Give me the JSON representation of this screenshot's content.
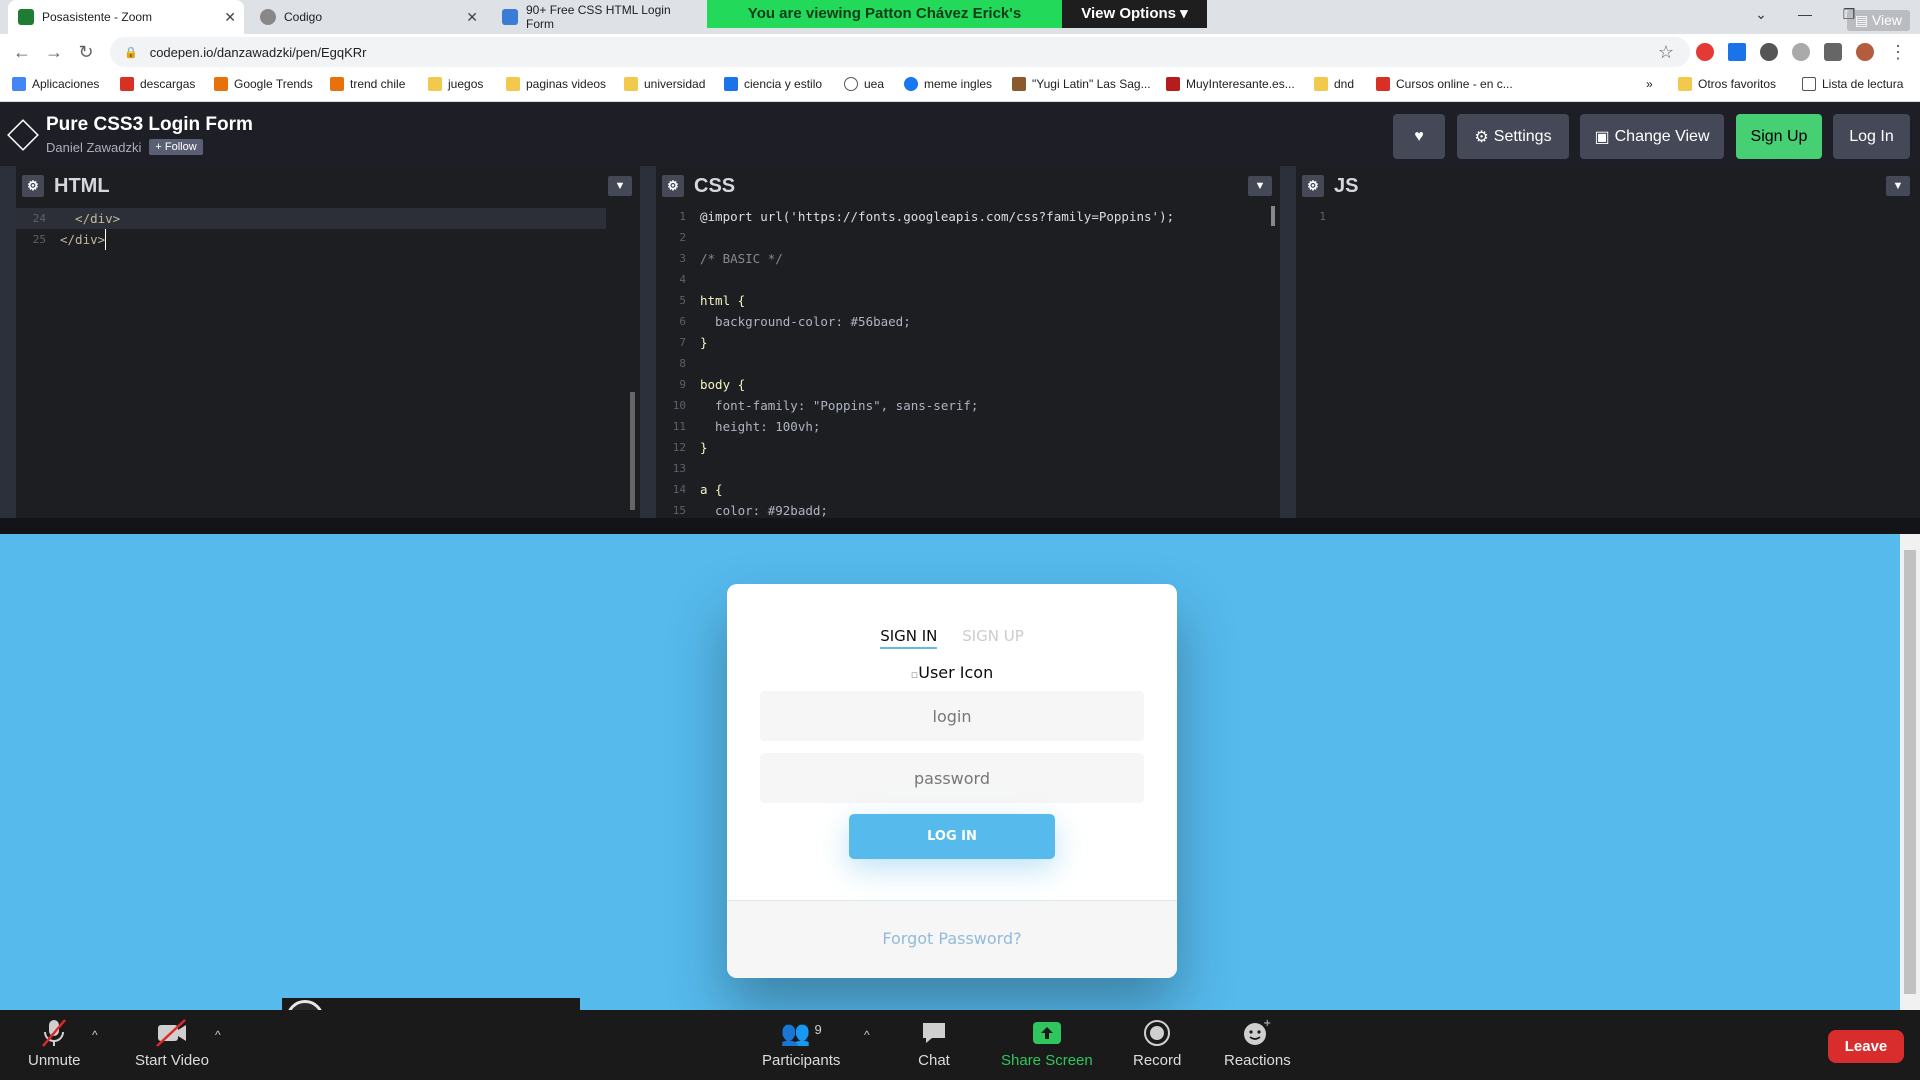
{
  "browser": {
    "tabs": [
      {
        "title": "Posasistente - Zoom"
      },
      {
        "title": "Codigo"
      },
      {
        "title": "90+ Free CSS HTML Login Form"
      }
    ],
    "url": "codepen.io/danzawadzki/pen/EgqKRr",
    "bookmarks": [
      "Aplicaciones",
      "descargas",
      "Google Trends",
      "trend chile",
      "juegos",
      "paginas videos",
      "universidad",
      "ciencia y estilo",
      "uea",
      "meme ingles",
      "\"Yugi Latin\" Las Sag...",
      "MuyInteresante.es...",
      "dnd",
      "Cursos online - en c..."
    ],
    "bookmarks_more": "»",
    "other_favorites": "Otros favoritos",
    "reading_list": "Lista de lectura"
  },
  "zoom_banner": {
    "viewing": "You are viewing Patton Chávez Erick's screen",
    "options": "View Options",
    "view": "View"
  },
  "codepen": {
    "title": "Pure CSS3 Login Form",
    "author": "Daniel Zawadzki",
    "follow": "+ Follow",
    "settings": "Settings",
    "change_view": "Change View",
    "signup": "Sign Up",
    "login": "Log In"
  },
  "editors": {
    "html_label": "HTML",
    "css_label": "CSS",
    "js_label": "JS",
    "html_lines": [
      {
        "n": "24",
        "text": "  </div>"
      },
      {
        "n": "25",
        "text": "</div>"
      }
    ],
    "css_lines": [
      {
        "n": "1",
        "text": "@import url('https://fonts.googleapis.com/css?family=Poppins');"
      },
      {
        "n": "2",
        "text": ""
      },
      {
        "n": "3",
        "text": "/* BASIC */"
      },
      {
        "n": "4",
        "text": ""
      },
      {
        "n": "5",
        "text": "html {"
      },
      {
        "n": "6",
        "text": "  background-color: #56baed;"
      },
      {
        "n": "7",
        "text": "}"
      },
      {
        "n": "8",
        "text": ""
      },
      {
        "n": "9",
        "text": "body {"
      },
      {
        "n": "10",
        "text": "  font-family: \"Poppins\", sans-serif;"
      },
      {
        "n": "11",
        "text": "  height: 100vh;"
      },
      {
        "n": "12",
        "text": "}"
      },
      {
        "n": "13",
        "text": ""
      },
      {
        "n": "14",
        "text": "a {"
      },
      {
        "n": "15",
        "text": "  color: #92badd;"
      }
    ],
    "js_lines": [
      {
        "n": "1",
        "text": ""
      }
    ]
  },
  "form": {
    "tab_signin": "SIGN IN",
    "tab_signup": "SIGN UP",
    "user_icon_alt": "User Icon",
    "login_placeholder": "login",
    "password_placeholder": "password",
    "login_button": "LOG IN",
    "forgot": "Forgot Password?"
  },
  "zoom_bar": {
    "unmute": "Unmute",
    "start_video": "Start Video",
    "participants": "Participants",
    "participants_count": "9",
    "chat": "Chat",
    "share_screen": "Share Screen",
    "record": "Record",
    "reactions": "Reactions",
    "leave": "Leave"
  },
  "colors": {
    "preview_bg": "#56baed",
    "link": "#92badd",
    "codepen_green": "#47cf73",
    "zoom_green": "#23d959",
    "leave_red": "#d92d2d"
  }
}
